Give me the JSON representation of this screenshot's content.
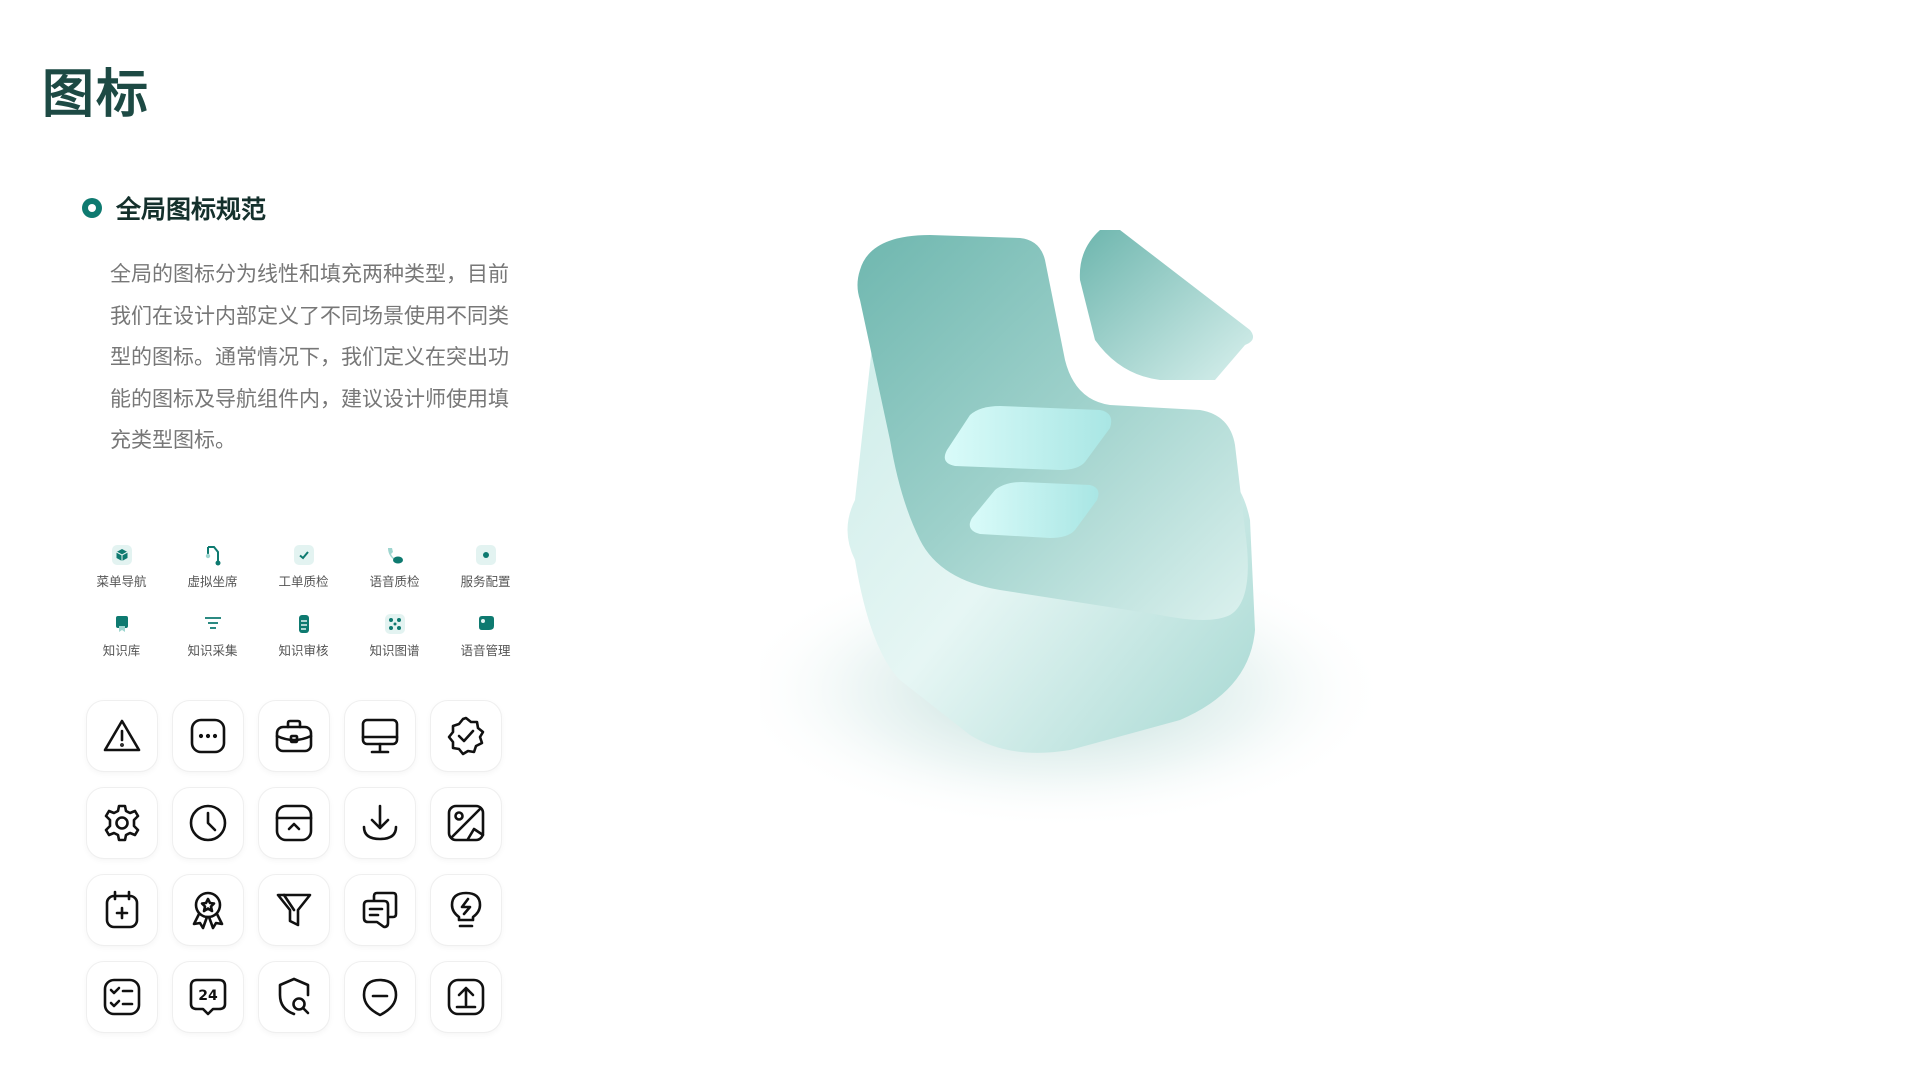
{
  "page": {
    "title": "图标"
  },
  "section": {
    "title": "全局图标规范",
    "description": "全局的图标分为线性和填充两种类型，目前我们在设计内部定义了不同场景使用不同类型的图标。通常情况下，我们定义在突出功能的图标及导航组件内，建议设计师使用填充类型图标。"
  },
  "colors": {
    "accent": "#0e7a70",
    "title": "#1d4a44",
    "hero_light": "#d6f2ef",
    "hero_mid": "#8ccbc4"
  },
  "filled_icons": [
    {
      "icon": "cube-icon",
      "label": "菜单导航"
    },
    {
      "icon": "route-icon",
      "label": "虚拟坐席"
    },
    {
      "icon": "checkmark-icon",
      "label": "工单质检"
    },
    {
      "icon": "phone-icon",
      "label": "语音质检"
    },
    {
      "icon": "hexagon-dot-icon",
      "label": "服务配置"
    },
    {
      "icon": "bookmark-icon",
      "label": "知识库"
    },
    {
      "icon": "list-icon",
      "label": "知识采集"
    },
    {
      "icon": "document-icon",
      "label": "知识审核"
    },
    {
      "icon": "graph-icon",
      "label": "知识图谱"
    },
    {
      "icon": "chat-bubble-icon",
      "label": "语音管理"
    }
  ],
  "line_icons": [
    "warning-icon",
    "more-dots-icon",
    "briefcase-icon",
    "monitor-icon",
    "verified-badge-icon",
    "settings-icon",
    "clock-icon",
    "archive-icon",
    "download-icon",
    "image-icon",
    "calendar-add-icon",
    "award-icon",
    "filter-icon",
    "copy-icon",
    "lightbulb-icon",
    "checklist-icon",
    "24-hours-icon",
    "shield-search-icon",
    "minus-circle-icon",
    "upload-icon"
  ],
  "hero": {
    "icon": "document-3d-icon"
  }
}
